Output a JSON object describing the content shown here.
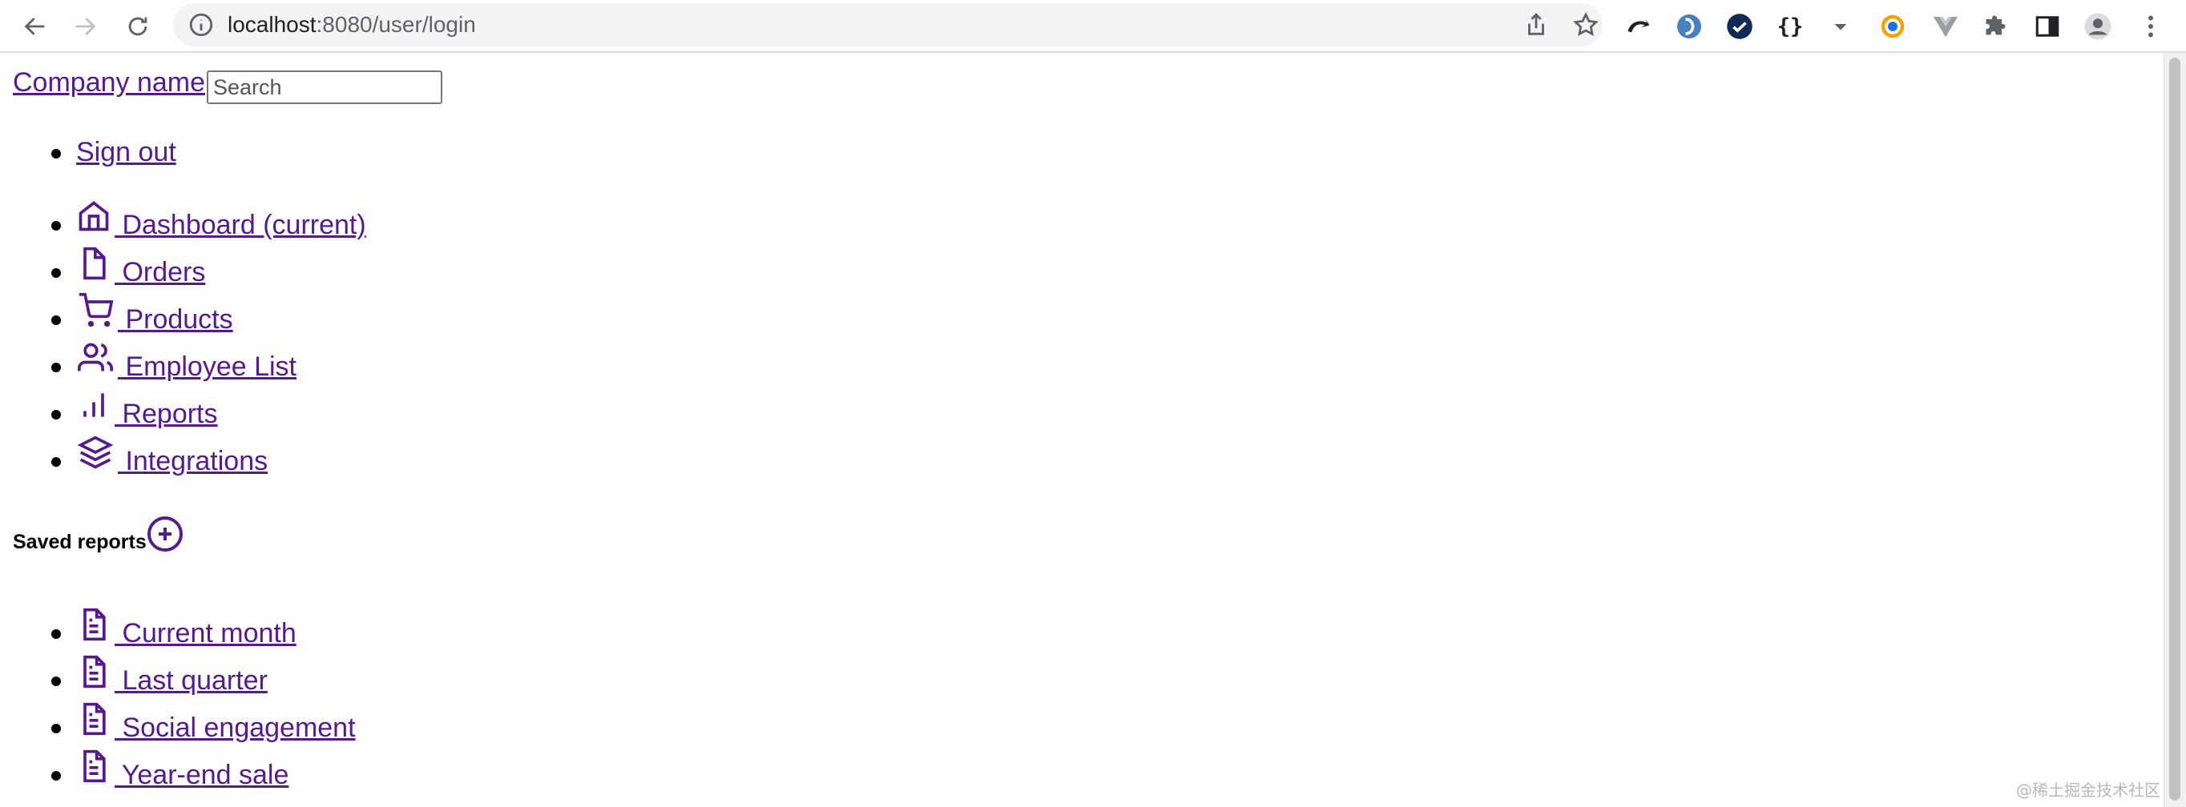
{
  "browser": {
    "url_host": "localhost",
    "url_path": ":8080/user/login"
  },
  "header": {
    "brand": "Company name",
    "search_placeholder": "Search"
  },
  "account_nav": {
    "sign_out": "Sign out"
  },
  "sidebar": {
    "items": [
      {
        "label": " Dashboard (current)",
        "icon": "home-icon"
      },
      {
        "label": " Orders",
        "icon": "file-icon"
      },
      {
        "label": " Products",
        "icon": "shopping-cart-icon"
      },
      {
        "label": " Employee List",
        "icon": "users-icon"
      },
      {
        "label": " Reports",
        "icon": "bar-chart-icon"
      },
      {
        "label": " Integrations",
        "icon": "layers-icon"
      }
    ],
    "saved_heading": "Saved reports",
    "saved_items": [
      {
        "label": " Current month",
        "icon": "file-text-icon"
      },
      {
        "label": " Last quarter",
        "icon": "file-text-icon"
      },
      {
        "label": " Social engagement",
        "icon": "file-text-icon"
      },
      {
        "label": " Year-end sale",
        "icon": "file-text-icon"
      }
    ]
  },
  "watermark": "@稀土掘金技术社区",
  "colors": {
    "link_visited": "#551a8b",
    "chrome_bg": "#f1f3f4"
  }
}
